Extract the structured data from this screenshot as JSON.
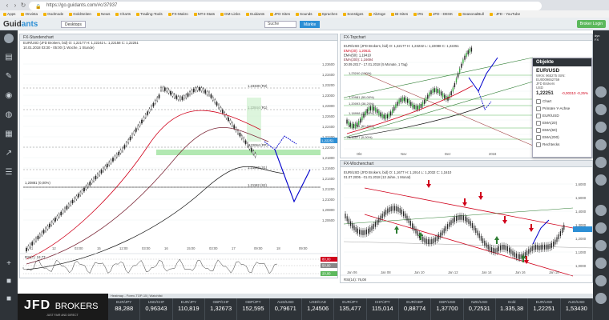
{
  "browser": {
    "url": "https://go.guidants.com/#c/37937",
    "bookmarks": [
      "Apps",
      "Onvista",
      "Godmode",
      "GoldSeiten",
      "News",
      "Charts",
      "Trading-Tools",
      "FX-Makro",
      "MT4-Stats",
      "GM-Links",
      "Guidants",
      "JFD Sites",
      "Sounds",
      "Sprachen",
      "Sonstiges",
      "Abzüge",
      "BI-Sites",
      "IRs",
      "JFD - DESK",
      "SeasonalBull",
      "- JFD - YouTube"
    ]
  },
  "header": {
    "logo_a": "Guid",
    "logo_b": "ants",
    "desktops_label": "Desktops",
    "search_label": "Suche",
    "markets_label": "Märkte",
    "login_label": "Broker Login"
  },
  "panels": {
    "hourly": {
      "title": "FX-Stundenchart",
      "info": "EUR/USD (JFD Brokers, bid) O: 1,22177  H: 1,22242  L: 1,22158  C: 1,22251",
      "info2": "10.01.2018 03:30 - 05:00  (1 Woche, 1 Stunde)",
      "ema_labels": [
        "EMA(20): 1,22284",
        "EMA(50): 1,22322",
        "EMA(100): 1,21876",
        "PP(D): 1,22449"
      ],
      "levels": [
        "1,23330 (R2)",
        "1,22844 (R1)",
        "1,22064 (PP)",
        "1,21560 (S1)",
        "1,21182 (S2)"
      ],
      "price_axis": [
        "1,23600",
        "1,23400",
        "1,23200",
        "1,23000",
        "1,22800",
        "1,22600",
        "1,22400",
        "1,22200",
        "1,22000",
        "1,21800",
        "1,21600",
        "1,21400",
        "1,21200",
        "1,21000",
        "1,20800",
        "1,20600"
      ],
      "current_price": "1,22251",
      "left_label": "1,20881 (0,00%)",
      "time_axis": [
        "11",
        "12",
        "03:00",
        "15",
        "12:00",
        "03:00",
        "16",
        "15:00",
        "03:00",
        "17",
        "09:00",
        "18",
        "09:00"
      ],
      "rsi_label": "RSI(7): 24,77",
      "rsi_levels": [
        "80,00",
        "50,00",
        "20,00"
      ]
    },
    "topchart": {
      "title": "FX-Topchart",
      "info": "EUR/USD (JFD Brokers, bid) O: 1,22177  H: 1,23232  L: 1,22088  C: 1,22251",
      "info2": [
        "EMA(20): 1,20621",
        "EMA(50): 1,19410",
        "EMA(200): 1,16694"
      ],
      "info3": "30.09.2017 - 17.01.2018  (5 Monate, 1 Tag)",
      "controls": [
        "Dia",
        "5 Monate",
        "1 Tag",
        "Extras"
      ],
      "fib_labels": [
        "1,23240 (100%)",
        "1,20981 (50,00%)",
        "1,20093 (38,20%)",
        "1,18998 (23,60%)",
        "1,17754 (61,80%)",
        "1,16577 (0,00%)"
      ],
      "price_axis": [
        "1,23000",
        "1,22251",
        "1,21000",
        "1,20000",
        "1,19000",
        "1,18000",
        "1,17000"
      ],
      "time_axis": [
        "Okt",
        "Nov",
        "Dez",
        "2018"
      ]
    },
    "weekly": {
      "title": "FX-Wochenchart",
      "info": "EUR/USD (JFD Brokers, bid) O: 1,1677  H: 1,1914  L: 1,2032  C: 1,1610",
      "info2": "01.07.2005 - 01.01.2018  (13 Jahre, 1 Monat)",
      "price_axis": [
        "1,6000",
        "1,5000",
        "1,4000",
        "1,3000",
        "1,2000",
        "1,1000",
        "1,0000"
      ],
      "time_axis": [
        "Jan 06",
        "Jan 08",
        "Jan 10",
        "Jan 12",
        "Jan 14",
        "Jan 16",
        "Jan 18"
      ],
      "rsi_label": "RSI(14): 76,08"
    }
  },
  "objekte": {
    "header": "Objekte",
    "name": "EUR/USD",
    "sub1": "WKN: 965275  ISIN: EU0009652759",
    "sub2": "JFD Brokers",
    "sub3": "USD",
    "price": "1,22251",
    "change": "-0,00310  -0,25%",
    "items": [
      "Chart",
      "Primäre Y-Achse",
      "EUR/USD",
      "EMA(20)",
      "EMA(50)",
      "EMA(200)",
      "Rechtecks"
    ]
  },
  "ticker": {
    "header": "Heatmap - Forex-TOP-15  |  Watchlist",
    "items": [
      {
        "name": "EUR/JPY",
        "value": "88,288"
      },
      {
        "name": "USD/CHF",
        "value": "0,96343"
      },
      {
        "name": "EUR/JPY",
        "value": "110,819"
      },
      {
        "name": "GBP/CHF",
        "value": "1,32673"
      },
      {
        "name": "GBP/JPY",
        "value": "152,595"
      },
      {
        "name": "AUD/USD",
        "value": "0,79671"
      },
      {
        "name": "USD/CAD",
        "value": "1,24506"
      },
      {
        "name": "EUR/JPY",
        "value": "135,477"
      },
      {
        "name": "CHF/JPY",
        "value": "115,014"
      },
      {
        "name": "EUR/GBP",
        "value": "0,88774"
      },
      {
        "name": "GBP/USD",
        "value": "1,37700"
      },
      {
        "name": "NZD/USD",
        "value": "0,72531"
      },
      {
        "name": "Gold",
        "value": "1.335,38"
      },
      {
        "name": "EUR/USD",
        "value": "1,22251"
      },
      {
        "name": "AUD/USD",
        "value": "1,53430"
      }
    ]
  },
  "ad": {
    "brand_a": "JFD",
    "brand_b": "BROKERS",
    "tagline": "JUST FAIR AND DIRECT"
  }
}
